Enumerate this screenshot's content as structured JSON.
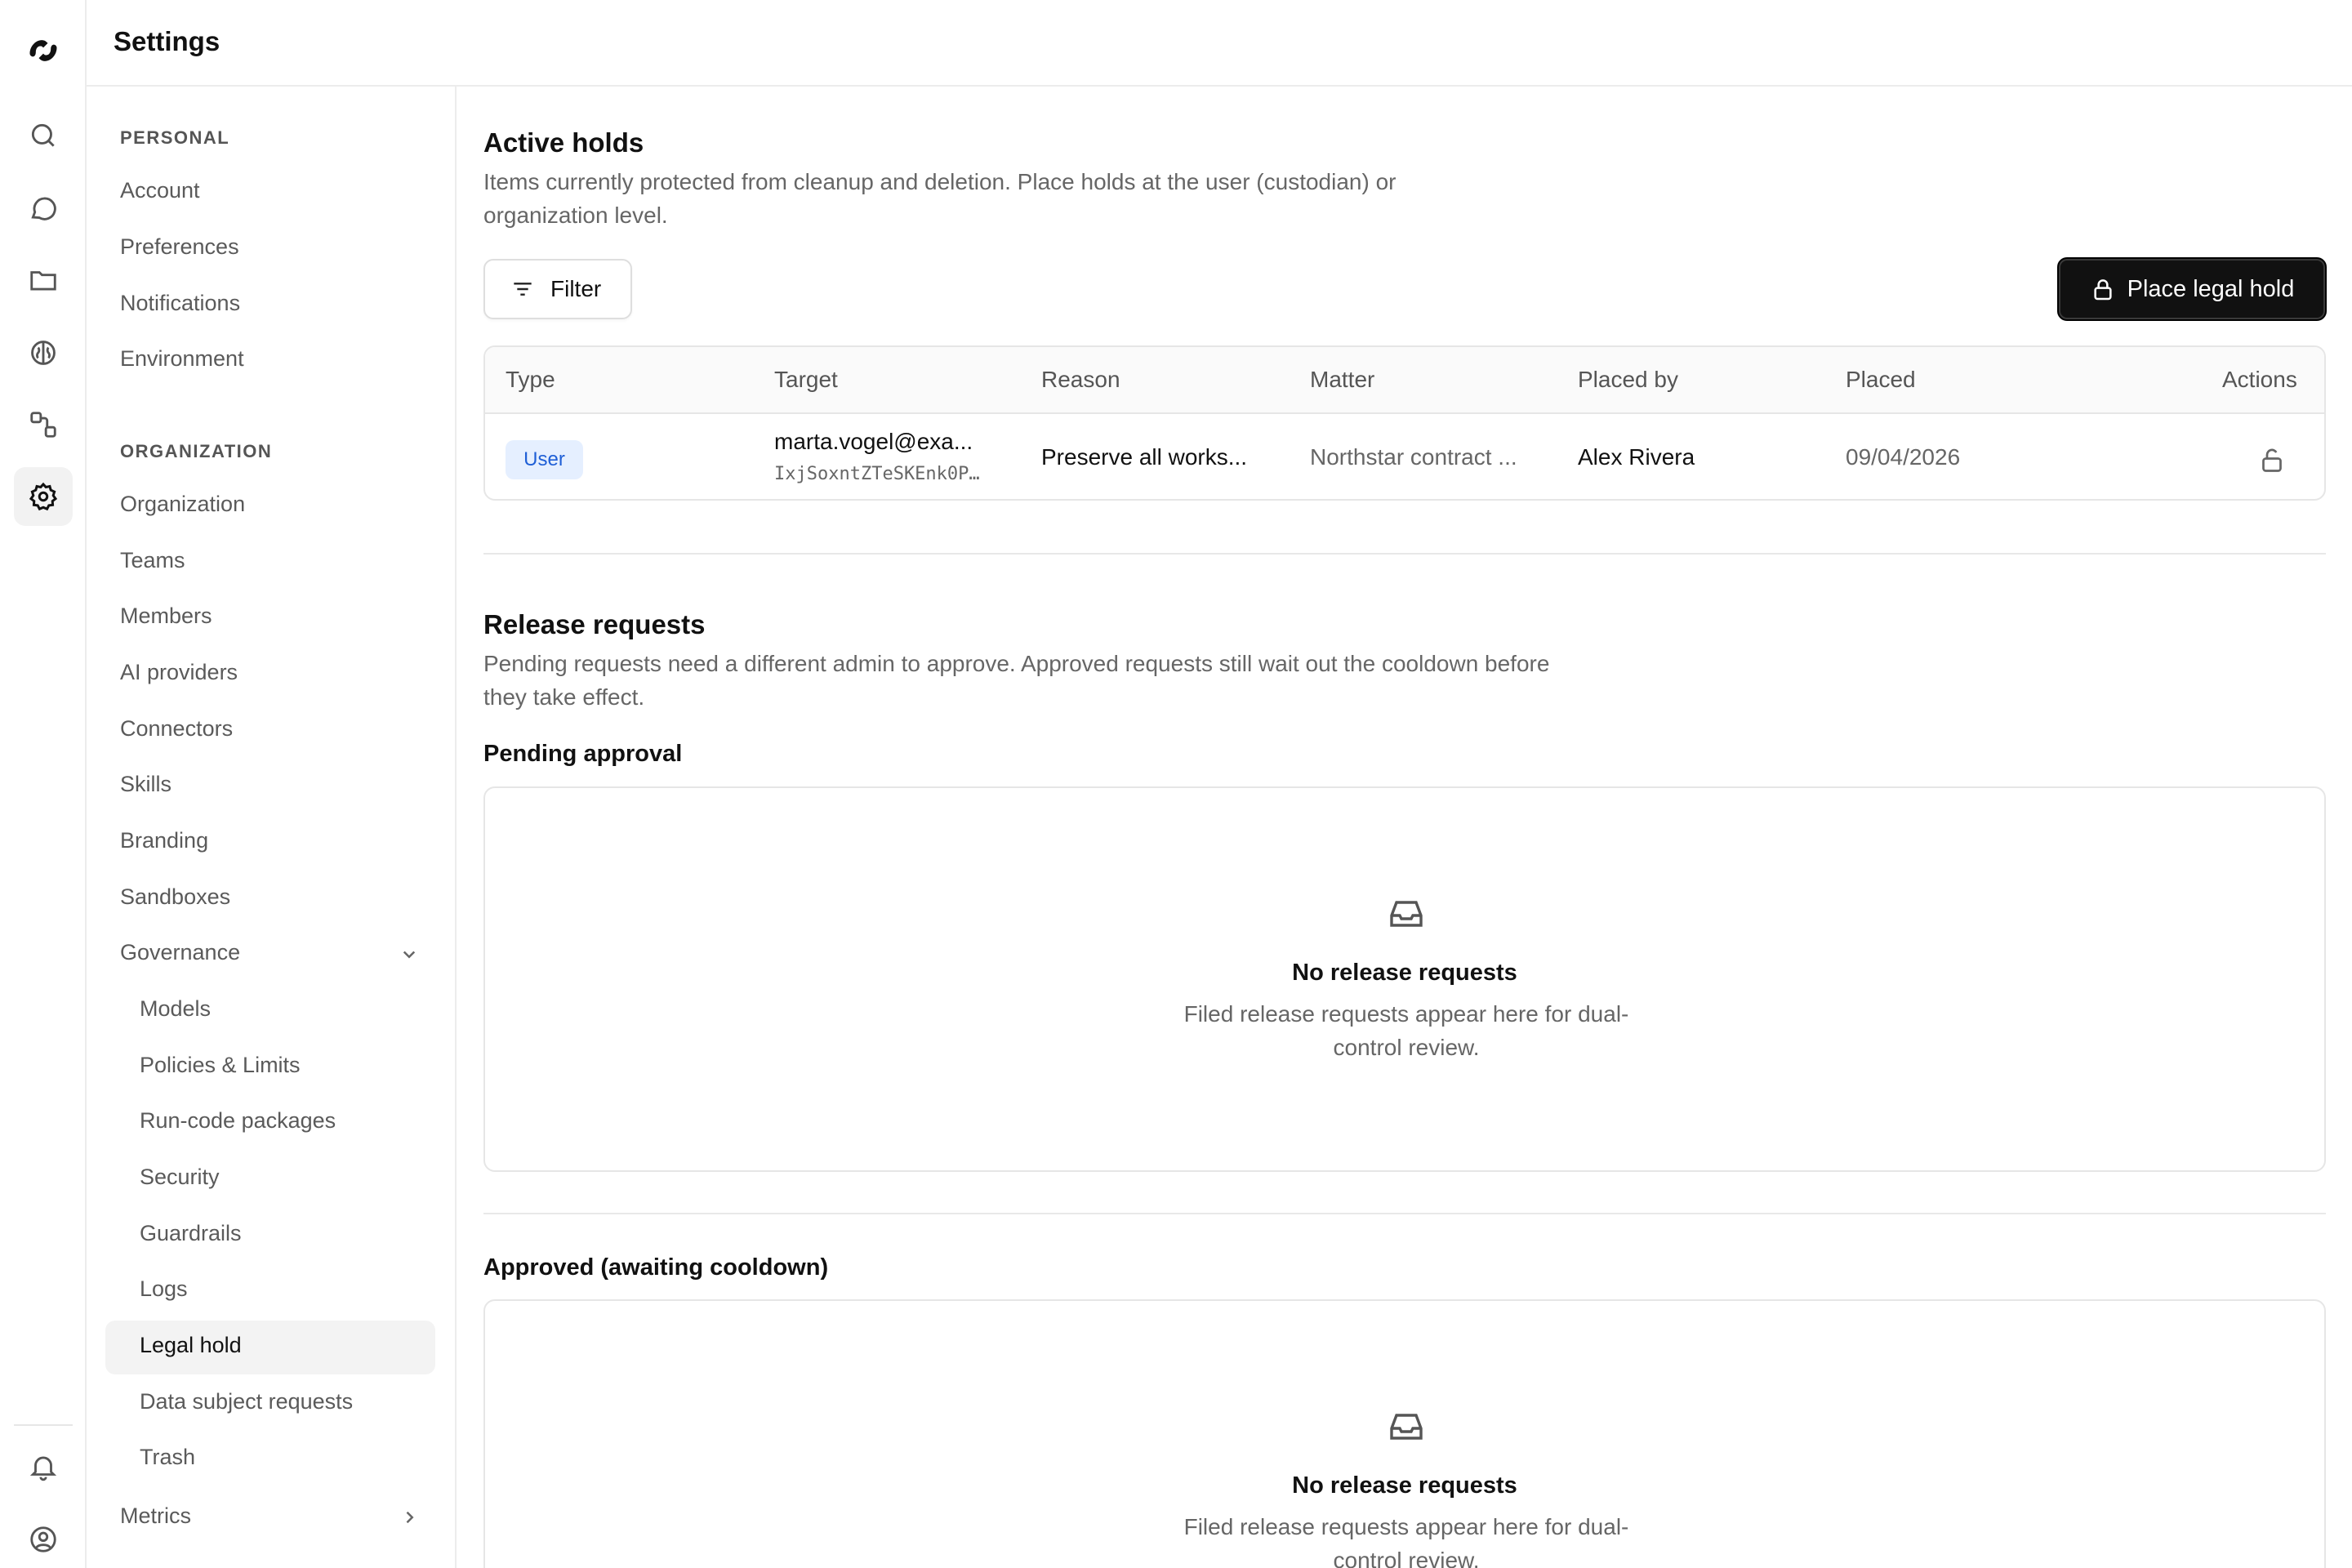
{
  "header": {
    "title": "Settings"
  },
  "sidebar": {
    "personal_heading": "PERSONAL",
    "personal": [
      "Account",
      "Preferences",
      "Notifications",
      "Environment"
    ],
    "organization_heading": "ORGANIZATION",
    "organization": [
      "Organization",
      "Teams",
      "Members",
      "AI providers",
      "Connectors",
      "Skills",
      "Branding",
      "Sandboxes"
    ],
    "governance_label": "Governance",
    "governance_items": [
      "Models",
      "Policies & Limits",
      "Run-code packages",
      "Security",
      "Guardrails",
      "Logs",
      "Legal hold",
      "Data subject requests",
      "Trash"
    ],
    "metrics_label": "Metrics",
    "active_item": "Legal hold"
  },
  "active_holds": {
    "title": "Active holds",
    "description": "Items currently protected from cleanup and deletion. Place holds at the user (custodian) or organization level.",
    "filter_label": "Filter",
    "place_hold_label": "Place legal hold",
    "columns": [
      "Type",
      "Target",
      "Reason",
      "Matter",
      "Placed by",
      "Placed",
      "Actions"
    ],
    "rows": [
      {
        "type": "User",
        "target": "marta.vogel@exa...",
        "target_id": "IxjSoxntZTeSKEnk0P…",
        "reason": "Preserve all works...",
        "matter": "Northstar contract ...",
        "placed_by": "Alex Rivera",
        "placed": "09/04/2026",
        "action_icon": "unlock-icon"
      }
    ]
  },
  "release_requests": {
    "title": "Release requests",
    "description": "Pending requests need a different admin to approve. Approved requests still wait out the cooldown before they take effect.",
    "pending_heading": "Pending approval",
    "approved_heading": "Approved (awaiting cooldown)",
    "empty_title": "No release requests",
    "empty_description": "Filed release requests appear here for dual-control review."
  },
  "rail_icons": [
    "logo-icon",
    "search-icon",
    "chat-icon",
    "folder-icon",
    "brain-icon",
    "workflow-icon",
    "settings-icon",
    "bell-icon",
    "user-circle-icon"
  ],
  "colors": {
    "primary_button": "#111111",
    "badge_bg": "#e5efff",
    "badge_text": "#1f5fd6",
    "active_bg": "#f3f3f3"
  }
}
